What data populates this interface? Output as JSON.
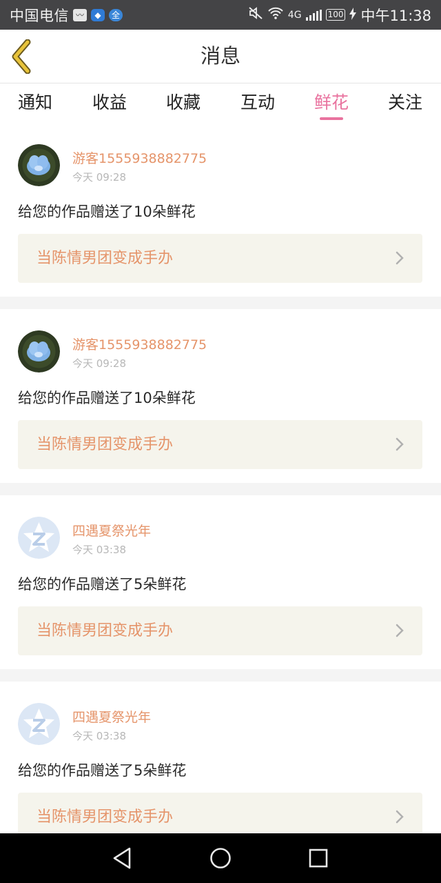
{
  "status_bar": {
    "carrier": "中国电信",
    "network": "4G",
    "battery": "100",
    "time": "中午11:38",
    "icons": [
      "activity-icon",
      "shield-icon",
      "quan-icon",
      "mute-icon",
      "wifi-icon",
      "signal-icon",
      "battery-icon",
      "charging-icon"
    ]
  },
  "header": {
    "title": "消息",
    "back_icon": "chevron-left-icon",
    "accent_color": "#e8c33a"
  },
  "tabs": [
    {
      "label": "通知",
      "active": false
    },
    {
      "label": "收益",
      "active": false
    },
    {
      "label": "收藏",
      "active": false
    },
    {
      "label": "互动",
      "active": false
    },
    {
      "label": "鲜花",
      "active": true
    },
    {
      "label": "关注",
      "active": false
    }
  ],
  "colors": {
    "active_tab": "#e9739f",
    "username": "#e5946a",
    "work_title": "#e5946a",
    "link_bg": "#f5f4ec"
  },
  "messages": [
    {
      "username": "游客1555938882775",
      "time": "今天 09:28",
      "text": "给您的作品赠送了10朵鲜花",
      "work_title": "当陈情男团变成手办",
      "avatar": "flower-avatar"
    },
    {
      "username": "游客1555938882775",
      "time": "今天 09:28",
      "text": "给您的作品赠送了10朵鲜花",
      "work_title": "当陈情男团变成手办",
      "avatar": "flower-avatar"
    },
    {
      "username": "四遇夏祭光年",
      "time": "今天 03:38",
      "text": "给您的作品赠送了5朵鲜花",
      "work_title": "当陈情男团变成手办",
      "avatar": "default-z-avatar"
    },
    {
      "username": "四遇夏祭光年",
      "time": "今天 03:38",
      "text": "给您的作品赠送了5朵鲜花",
      "work_title": "当陈情男团变成手办",
      "avatar": "default-z-avatar"
    }
  ],
  "nav_bar": {
    "buttons": [
      "back-triangle-icon",
      "home-circle-icon",
      "recents-square-icon"
    ]
  }
}
